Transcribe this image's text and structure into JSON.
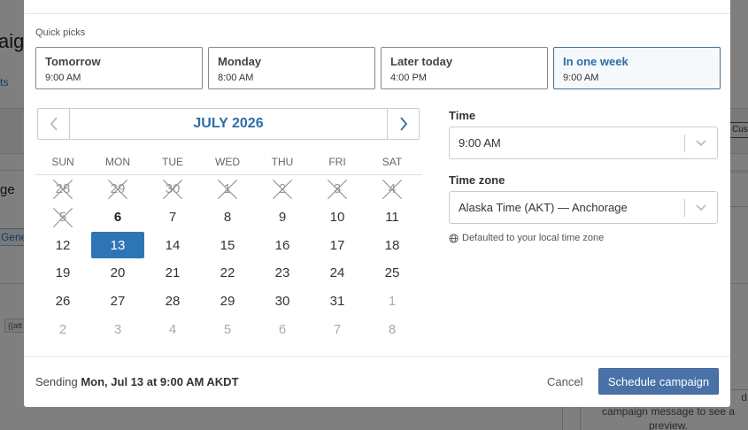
{
  "background": {
    "title": "aig",
    "link": "ts",
    "subtitle": "ge",
    "chip": "Gener",
    "tag": "{{att",
    "right_button": "Custom",
    "preview_lines": [
      "d",
      "campaign message to see a",
      "preview."
    ]
  },
  "quick_picks": {
    "label": "Quick picks",
    "items": [
      {
        "title": "Tomorrow",
        "time": "9:00 AM"
      },
      {
        "title": "Monday",
        "time": "8:00 AM"
      },
      {
        "title": "Later today",
        "time": "4:00 PM"
      },
      {
        "title": "In one week",
        "time": "9:00 AM"
      }
    ]
  },
  "calendar": {
    "month_label": "JULY 2026",
    "weekdays": [
      "SUN",
      "MON",
      "TUE",
      "WED",
      "THU",
      "FRI",
      "SAT"
    ],
    "weeks": [
      [
        {
          "d": "28",
          "s": "past"
        },
        {
          "d": "29",
          "s": "past"
        },
        {
          "d": "30",
          "s": "past"
        },
        {
          "d": "1",
          "s": "past"
        },
        {
          "d": "2",
          "s": "past"
        },
        {
          "d": "3",
          "s": "past"
        },
        {
          "d": "4",
          "s": "past"
        }
      ],
      [
        {
          "d": "5",
          "s": "past"
        },
        {
          "d": "6",
          "s": "today"
        },
        {
          "d": "7",
          "s": ""
        },
        {
          "d": "8",
          "s": ""
        },
        {
          "d": "9",
          "s": ""
        },
        {
          "d": "10",
          "s": ""
        },
        {
          "d": "11",
          "s": ""
        }
      ],
      [
        {
          "d": "12",
          "s": ""
        },
        {
          "d": "13",
          "s": "selected"
        },
        {
          "d": "14",
          "s": ""
        },
        {
          "d": "15",
          "s": ""
        },
        {
          "d": "16",
          "s": ""
        },
        {
          "d": "17",
          "s": ""
        },
        {
          "d": "18",
          "s": ""
        }
      ],
      [
        {
          "d": "19",
          "s": ""
        },
        {
          "d": "20",
          "s": ""
        },
        {
          "d": "21",
          "s": ""
        },
        {
          "d": "22",
          "s": ""
        },
        {
          "d": "23",
          "s": ""
        },
        {
          "d": "24",
          "s": ""
        },
        {
          "d": "25",
          "s": ""
        }
      ],
      [
        {
          "d": "26",
          "s": ""
        },
        {
          "d": "27",
          "s": ""
        },
        {
          "d": "28",
          "s": ""
        },
        {
          "d": "29",
          "s": ""
        },
        {
          "d": "30",
          "s": ""
        },
        {
          "d": "31",
          "s": ""
        },
        {
          "d": "1",
          "s": "outside"
        }
      ],
      [
        {
          "d": "2",
          "s": "outside"
        },
        {
          "d": "3",
          "s": "outside"
        },
        {
          "d": "4",
          "s": "outside"
        },
        {
          "d": "5",
          "s": "outside"
        },
        {
          "d": "6",
          "s": "outside"
        },
        {
          "d": "7",
          "s": "outside"
        },
        {
          "d": "8",
          "s": "outside"
        }
      ]
    ]
  },
  "time_field": {
    "label": "Time",
    "value": "9:00 AM"
  },
  "timezone_field": {
    "label": "Time zone",
    "value": "Alaska Time (AKT) — Anchorage",
    "hint": "Defaulted to your local time zone"
  },
  "footer": {
    "sending_prefix": "Sending",
    "sending_value": "Mon, Jul 13 at 9:00 AM AKDT",
    "cancel_label": "Cancel",
    "schedule_label": "Schedule campaign"
  },
  "colors": {
    "accent": "#2e75b6",
    "primary_button": "#4a72a8"
  }
}
